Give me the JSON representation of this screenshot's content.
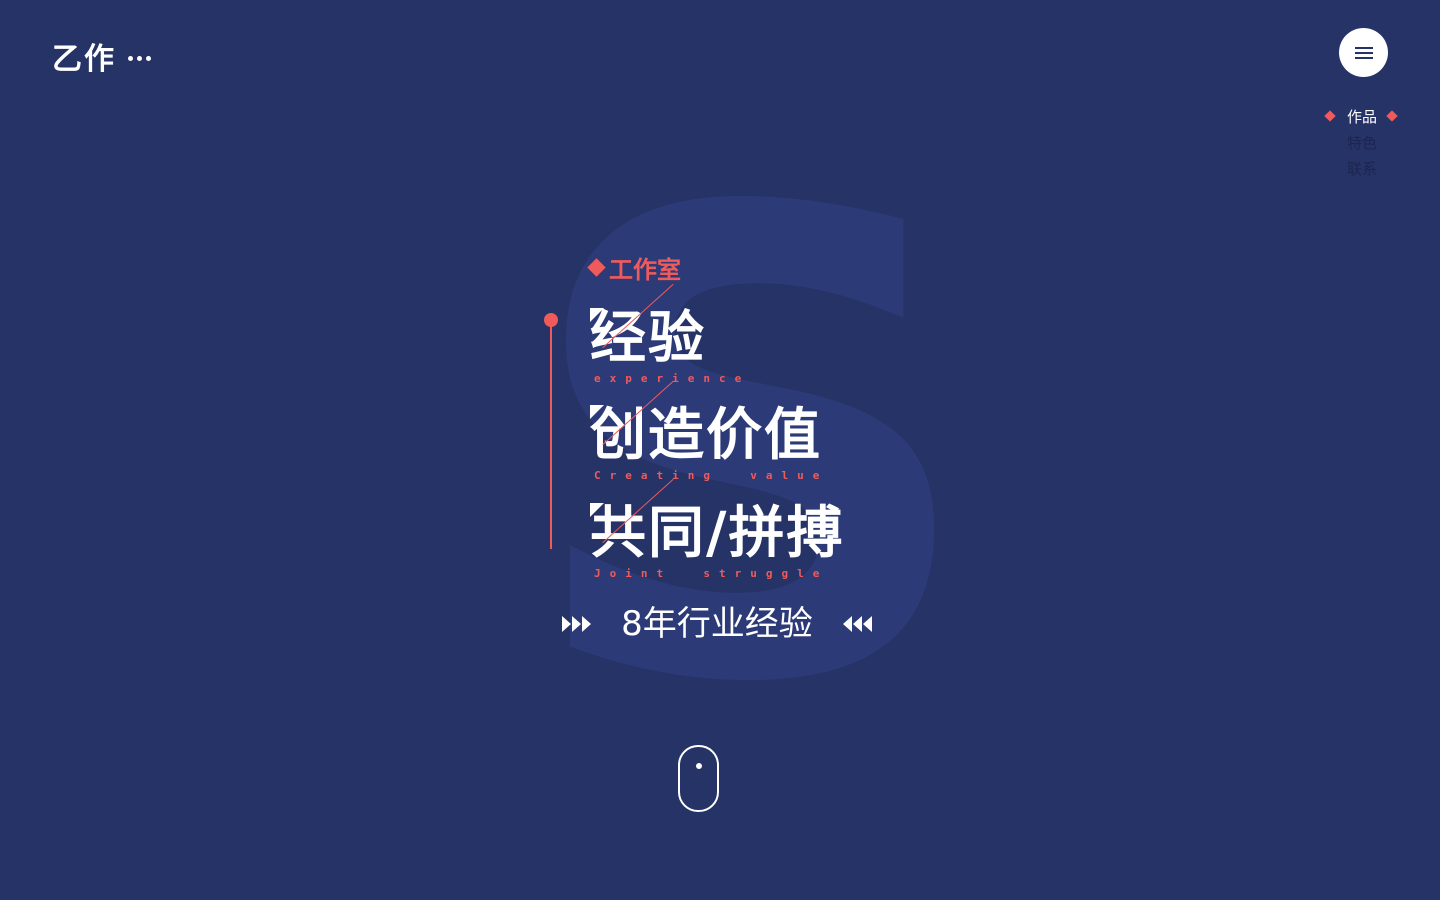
{
  "header": {
    "logo_text": "乙作",
    "menu_icon": "hamburger-menu-icon"
  },
  "side_nav": {
    "items": [
      {
        "label": "作品",
        "active": true
      },
      {
        "label": "特色",
        "active": false
      },
      {
        "label": "联系",
        "active": false
      }
    ]
  },
  "hero": {
    "background_letter": "S",
    "tag": "工作室",
    "slogans": [
      {
        "cn": "经验",
        "en": "experience"
      },
      {
        "cn": "创造价值",
        "en": "Creating  value"
      },
      {
        "cn": "共同/拼搏",
        "en": "Joint  struggle"
      }
    ],
    "years_text": "8年行业经验"
  },
  "scroll_indicator": {
    "icon": "mouse-scroll-icon"
  },
  "colors": {
    "background": "#263367",
    "accent": "#f05a5b",
    "text": "#ffffff",
    "nav_inactive": "#1c2550"
  }
}
